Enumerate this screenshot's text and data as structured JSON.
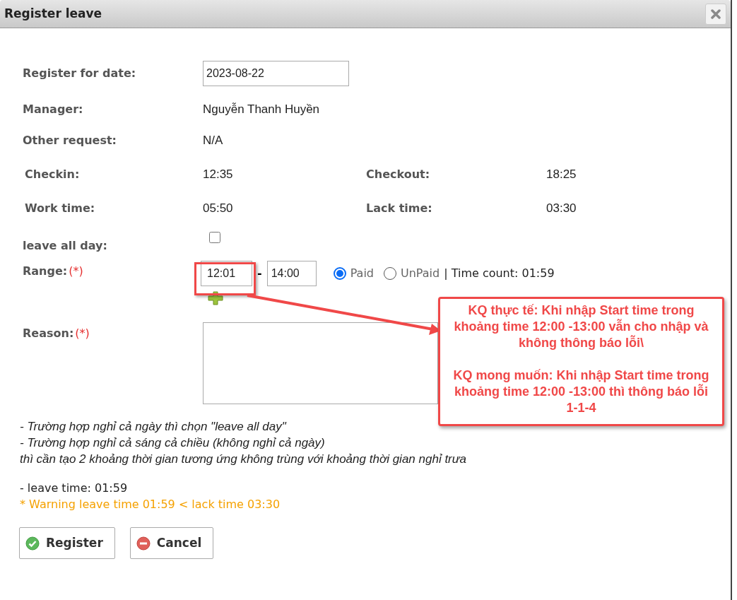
{
  "window": {
    "title": "Register leave"
  },
  "fields": {
    "register_for_date": {
      "label": "Register for date:",
      "value": "2023-08-22"
    },
    "manager": {
      "label": "Manager:",
      "value": "Nguyễn Thanh Huyền"
    },
    "other_request": {
      "label": "Other request:",
      "value": "N/A"
    },
    "checkin": {
      "label": "Checkin:",
      "value": "12:35"
    },
    "checkout": {
      "label": "Checkout:",
      "value": "18:25"
    },
    "work_time": {
      "label": "Work time:",
      "value": "05:50"
    },
    "lack_time": {
      "label": "Lack time:",
      "value": "03:30"
    },
    "leave_all_day": {
      "label": "leave all day:",
      "checked": false
    },
    "range": {
      "label": "Range:",
      "required": "(*)",
      "start": "12:01",
      "dash": "-",
      "end": "14:00",
      "pay_options": [
        {
          "label": "Paid",
          "selected": true
        },
        {
          "label": "UnPaid",
          "selected": false
        }
      ],
      "time_count": "| Time count: 01:59"
    },
    "reason": {
      "label": "Reason:",
      "required": "(*)"
    }
  },
  "notes": [
    "- Trường hợp nghỉ cả ngày thì chọn \"leave all day\"",
    "- Trường hợp nghỉ cả sáng cả chiều (không nghỉ cả ngày)",
    "thì cần tạo 2 khoảng thời gian tương ứng không trùng với khoảng thời gian nghỉ trưa"
  ],
  "leave_time": "- leave time: 01:59",
  "warning": "* Warning leave time 01:59 < lack time 03:30",
  "buttons": [
    {
      "kind": "ok",
      "label": "Register"
    },
    {
      "kind": "cancel",
      "label": "Cancel"
    }
  ],
  "annotation": {
    "paragraphs": [
      "KQ thực tế: Khi nhập Start time trong khoảng time 12:00 -13:00 vẫn cho nhập và không thông báo lỗi\\",
      "KQ mong muốn: Khi nhập Start time trong khoảng time 12:00 -13:00 thì thông báo lỗi 1-1-4"
    ]
  }
}
